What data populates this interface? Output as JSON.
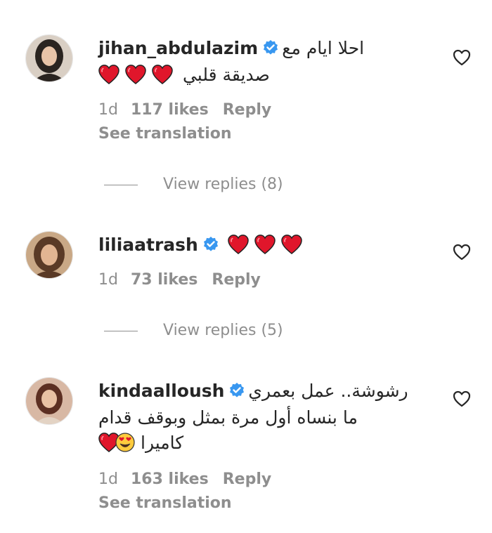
{
  "comments": [
    {
      "username": "jihan_abdulazim",
      "text_line1": "احلا ايام مع",
      "text_line2": "صديقة قلبي",
      "time": "1d",
      "likes": "117 likes",
      "reply": "Reply",
      "see_translation": "See translation",
      "view_replies": "View replies (8)",
      "avatar_bg": "#d9cfc4",
      "avatar_hair": "#2a2420",
      "avatar_skin": "#e8c4a8"
    },
    {
      "username": "liliaatrash",
      "time": "1d",
      "likes": "73 likes",
      "reply": "Reply",
      "view_replies": "View replies (5)",
      "avatar_bg": "#c9a886",
      "avatar_hair": "#5a3a26",
      "avatar_skin": "#e2b592"
    },
    {
      "username": "kindaalloush",
      "text_line1": "رشوشة.. عمل بعمري",
      "text_line2": "ما بنساه أول مرة بمثل وبوقف قدام",
      "text_line3": "كاميرا",
      "time": "1d",
      "likes": "163 likes",
      "reply": "Reply",
      "see_translation": "See translation",
      "avatar_bg": "#d8b8a4",
      "avatar_hair": "#5c2f22",
      "avatar_skin": "#e9c1a3"
    }
  ],
  "colors": {
    "verified_badge": "#3897f0",
    "heart_emoji": "#e0162b",
    "secondary_text": "#8e8e8e"
  },
  "icons": {
    "verified": "verified-badge-icon",
    "like": "heart-outline-icon",
    "heart_emoji": "red-heart-emoji",
    "face_emoji": "heart-eyes-emoji"
  }
}
